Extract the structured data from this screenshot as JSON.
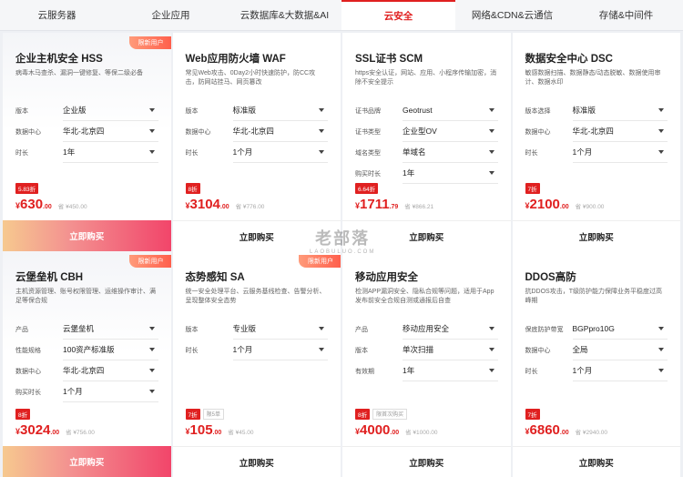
{
  "tabs": [
    "云服务器",
    "企业应用",
    "云数据库&大数据&AI",
    "云安全",
    "网络&CDN&云通信",
    "存储&中间件"
  ],
  "active_tab": 3,
  "watermark": {
    "cn": "老部落",
    "en": "LAOBULUO.COM"
  },
  "buy_label": "立即购买",
  "cards": [
    {
      "badge": "限新用户",
      "title": "企业主机安全 HSS",
      "desc": "病毒木马查杀、漏洞一键修复、等保二级必备",
      "options": [
        {
          "label": "版本",
          "value": "企业版"
        },
        {
          "label": "数据中心",
          "value": "华北-北京四"
        },
        {
          "label": "时长",
          "value": "1年"
        }
      ],
      "discount": "5.83折",
      "offer": "",
      "currency": "¥",
      "price": "630",
      "cents": ".00",
      "original": "省 ¥450.00",
      "highlight": true
    },
    {
      "badge": "",
      "title": "Web应用防火墙 WAF",
      "desc": "常见Web攻击、0Day2小时快速防护，防CC攻击，防网站挂马、网页篡改",
      "options": [
        {
          "label": "版本",
          "value": "标准版"
        },
        {
          "label": "数据中心",
          "value": "华北-北京四"
        },
        {
          "label": "时长",
          "value": "1个月"
        }
      ],
      "discount": "8折",
      "offer": "",
      "currency": "¥",
      "price": "3104",
      "cents": ".00",
      "original": "省 ¥776.00",
      "highlight": false
    },
    {
      "badge": "",
      "title": "SSL证书 SCM",
      "desc": "https安全认证，网站、应用、小程序传输加密，消除不安全提示",
      "options": [
        {
          "label": "证书品牌",
          "value": "Geotrust"
        },
        {
          "label": "证书类型",
          "value": "企业型OV"
        },
        {
          "label": "域名类型",
          "value": "单域名"
        },
        {
          "label": "购买时长",
          "value": "1年"
        }
      ],
      "discount": "6.64折",
      "offer": "",
      "currency": "¥",
      "price": "1711",
      "cents": ".79",
      "original": "省 ¥866.21",
      "highlight": false
    },
    {
      "badge": "",
      "title": "数据安全中心 DSC",
      "desc": "敏感数据扫描、数据静态/动态脱敏、数据使用审计、数据水印",
      "options": [
        {
          "label": "版本选择",
          "value": "标准版"
        },
        {
          "label": "数据中心",
          "value": "华北-北京四"
        },
        {
          "label": "时长",
          "value": "1个月"
        }
      ],
      "discount": "7折",
      "offer": "",
      "currency": "¥",
      "price": "2100",
      "cents": ".00",
      "original": "省 ¥900.00",
      "highlight": false
    },
    {
      "badge": "限新用户",
      "title": "云堡垒机 CBH",
      "desc": "主机资源管理、账号权限管理、运维操作审计、满足等保合规",
      "options": [
        {
          "label": "产品",
          "value": "云堡垒机"
        },
        {
          "label": "性能规格",
          "value": "100资产标准版"
        },
        {
          "label": "数据中心",
          "value": "华北-北京四"
        },
        {
          "label": "购买时长",
          "value": "1个月"
        }
      ],
      "discount": "8折",
      "offer": "",
      "currency": "¥",
      "price": "3024",
      "cents": ".00",
      "original": "省 ¥756.00",
      "highlight": true
    },
    {
      "badge": "限新用户",
      "title": "态势感知 SA",
      "desc": "统一安全处理平台、云服务基线检查、告警分析、呈现整体安全态势",
      "options": [
        {
          "label": "版本",
          "value": "专业版"
        },
        {
          "label": "时长",
          "value": "1个月"
        }
      ],
      "discount": "7折",
      "offer": "限5单",
      "currency": "¥",
      "price": "105",
      "cents": ".00",
      "original": "省 ¥45.00",
      "highlight": false
    },
    {
      "badge": "",
      "title": "移动应用安全",
      "desc": "检测APP漏洞安全、隐私合规等问题，适用于App发布前安全合规自测或通报后自查",
      "options": [
        {
          "label": "产品",
          "value": "移动应用安全"
        },
        {
          "label": "版本",
          "value": "单次扫描"
        },
        {
          "label": "有效期",
          "value": "1年"
        }
      ],
      "discount": "8折",
      "offer": "限首次购买",
      "currency": "¥",
      "price": "4000",
      "cents": ".00",
      "original": "省 ¥1000.00",
      "highlight": false
    },
    {
      "badge": "",
      "title": "DDOS高防",
      "desc": "抗DDOS攻击，T级防护能力保障业务平稳度过高峰期",
      "options": [
        {
          "label": "保底防护带宽",
          "value": "BGPpro10G"
        },
        {
          "label": "数据中心",
          "value": "全局"
        },
        {
          "label": "时长",
          "value": "1个月"
        }
      ],
      "discount": "7折",
      "offer": "",
      "currency": "¥",
      "price": "6860",
      "cents": ".00",
      "original": "省 ¥2940.00",
      "highlight": false
    }
  ]
}
